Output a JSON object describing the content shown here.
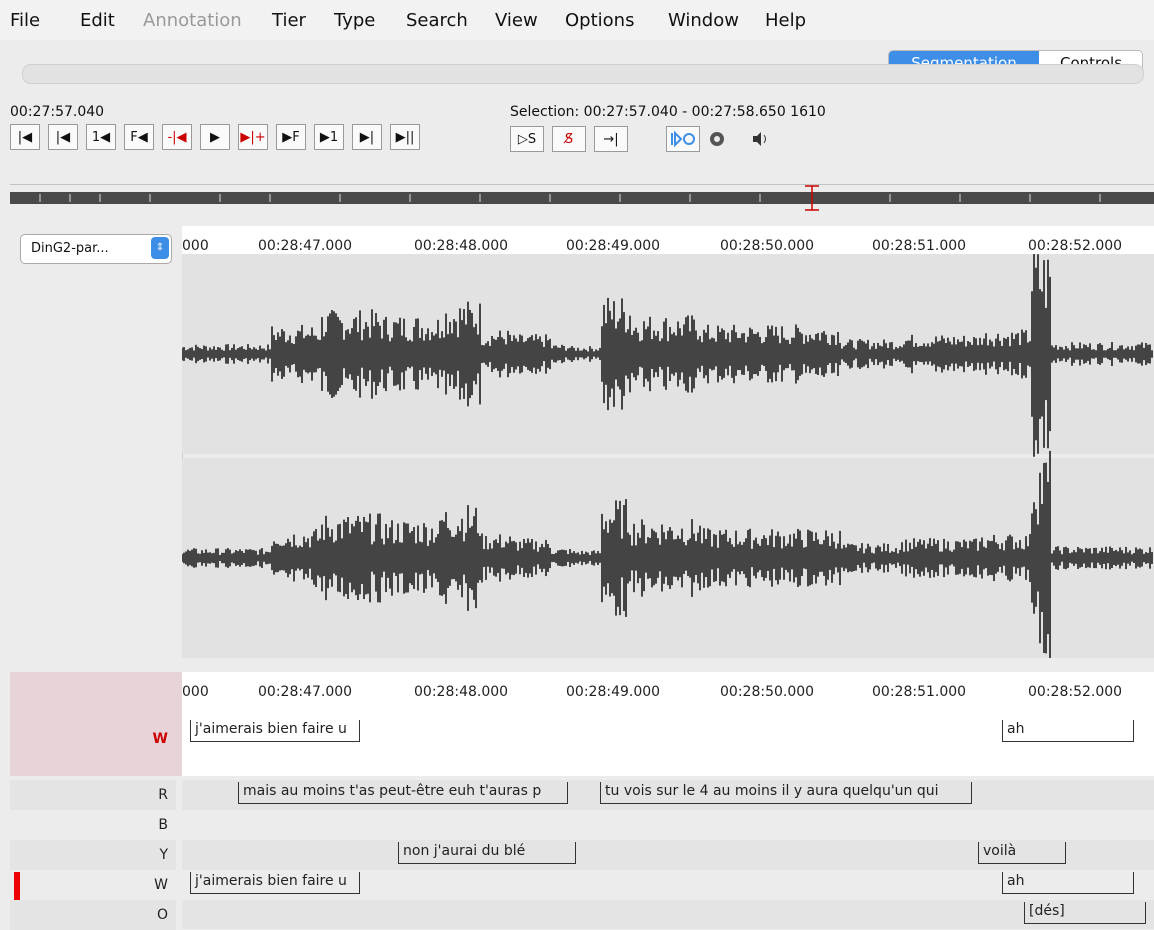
{
  "menu": [
    "File",
    "Edit",
    "Annotation",
    "Tier",
    "Type",
    "Search",
    "View",
    "Options",
    "Window",
    "Help"
  ],
  "mode_tabs": {
    "segmentation": "Segmentation",
    "controls": "Controls"
  },
  "current_time": "00:27:57.040",
  "selection": "Selection: 00:27:57.040 - 00:27:58.650  1610",
  "transport": [
    "|◀",
    "|◀",
    "1◀",
    "F◀",
    "-|◀",
    "▶",
    "▶|+",
    "▶F",
    "▶1",
    "▶|",
    "▶||"
  ],
  "selection_buttons": [
    "▷S",
    "S̸",
    "→|"
  ],
  "media_select": "DinG2-par...",
  "ruler_labels": [
    "000",
    "00:28:47.000",
    "00:28:48.000",
    "00:28:49.000",
    "00:28:50.000",
    "00:28:51.000",
    "00:28:52.000"
  ],
  "tiers": [
    {
      "name": "W",
      "active": true,
      "annotations": [
        {
          "text": "j'aimerais bien faire u"
        },
        {
          "text": "ah"
        }
      ]
    },
    {
      "name": "R",
      "annotations": [
        {
          "text": "mais au moins t'as peut-être euh t'auras p"
        },
        {
          "text": "tu vois sur le 4 au moins il y aura quelqu'un qui"
        }
      ]
    },
    {
      "name": "B",
      "annotations": []
    },
    {
      "name": "Y",
      "annotations": [
        {
          "text": "non j'aurai du blé"
        },
        {
          "text": "voilà"
        }
      ]
    },
    {
      "name": "W",
      "annotations": [
        {
          "text": "j'aimerais bien faire u"
        },
        {
          "text": "ah"
        }
      ]
    },
    {
      "name": "O",
      "annotations": [
        {
          "text": "[dés]"
        }
      ]
    }
  ],
  "colors": {
    "accent": "#3e8ee8",
    "active_tier": "#e8d4d8",
    "crosshair": "#cc0000"
  }
}
